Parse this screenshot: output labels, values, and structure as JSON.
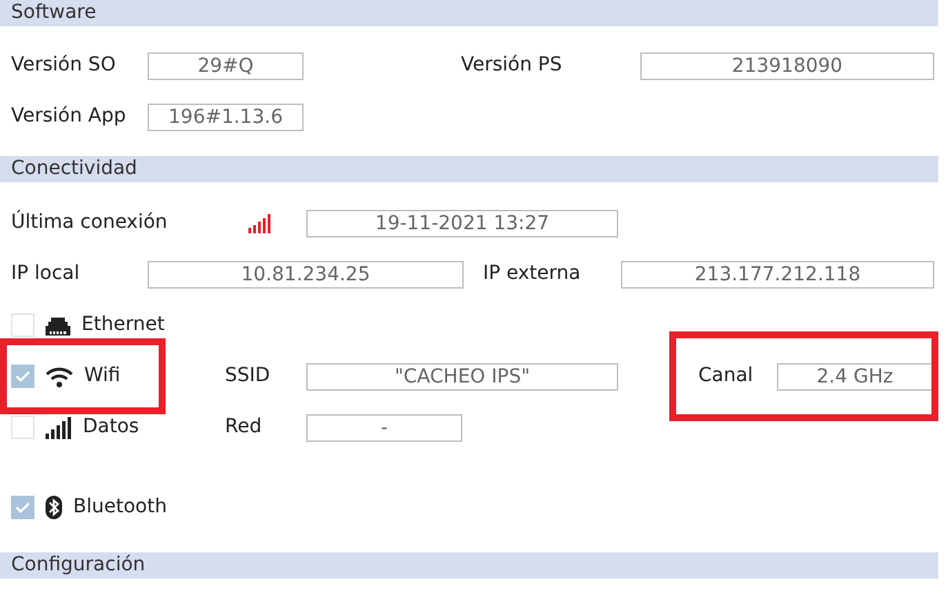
{
  "sections": [
    {
      "title": "Software",
      "rows": [
        [
          {
            "kind": "label",
            "text": "Versión SO"
          },
          {
            "kind": "field",
            "value": "29#Q"
          },
          {
            "kind": "label",
            "text": "Versión PS"
          },
          {
            "kind": "field",
            "value": "213918090"
          }
        ],
        [
          {
            "kind": "label",
            "text": "Versión App"
          },
          {
            "kind": "field",
            "value": "196#1.13.6"
          }
        ]
      ]
    },
    {
      "title": "Conectividad",
      "rows": [
        [
          {
            "kind": "label",
            "text": "Última conexión"
          },
          {
            "kind": "signal"
          },
          {
            "kind": "field",
            "value": "19-11-2021 13:27"
          }
        ],
        [
          {
            "kind": "label",
            "text": "IP local"
          },
          {
            "kind": "field",
            "value": "10.81.234.25"
          },
          {
            "kind": "label",
            "text": "IP externa"
          },
          {
            "kind": "field",
            "value": "213.177.212.118"
          }
        ],
        [
          {
            "kind": "option",
            "checked": false,
            "highlighted": false,
            "label": "Ethernet"
          }
        ],
        [
          {
            "kind": "option",
            "checked": true,
            "highlighted": true,
            "label": "Wifi"
          },
          {
            "kind": "label",
            "text": "SSID"
          },
          {
            "kind": "field",
            "value": "\"CACHEO IPS\""
          },
          {
            "kind": "group",
            "highlighted": true,
            "items": [
              {
                "kind": "label",
                "text": "Canal"
              },
              {
                "kind": "field",
                "value": "2.4 GHz"
              }
            ]
          }
        ],
        [
          {
            "kind": "option",
            "checked": false,
            "highlighted": false,
            "label": "Datos"
          },
          {
            "kind": "label",
            "text": "Red"
          },
          {
            "kind": "field",
            "value": "-"
          }
        ],
        [
          {
            "kind": "option",
            "checked": true,
            "highlighted": false,
            "label": "Bluetooth"
          }
        ]
      ]
    },
    {
      "title": "Configuración"
    }
  ]
}
